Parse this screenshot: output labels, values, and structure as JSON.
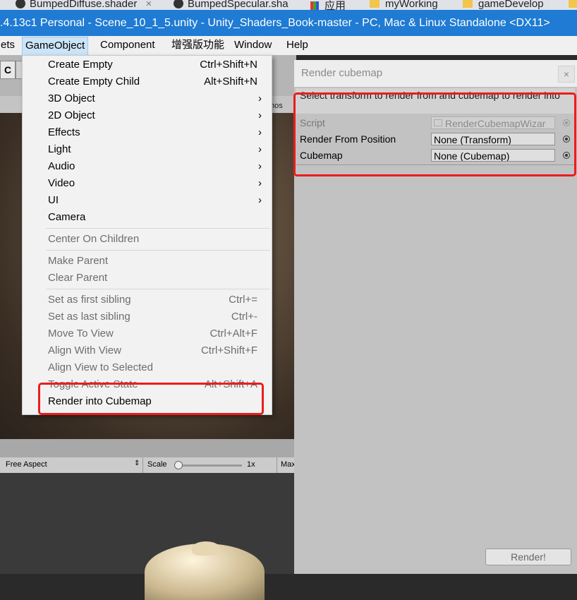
{
  "browser_tabs": [
    {
      "label": "BumpedDiffuse.shader",
      "close": "×"
    },
    {
      "label": "BumpedSpecular.sha"
    }
  ],
  "bookmarks": [
    "应用",
    "myWorking",
    "gameDevelop"
  ],
  "window_title": ".4.13c1 Personal - Scene_10_1_5.unity - Unity_Shaders_Book-master - PC, Mac & Linux Standalone <DX11>",
  "menubar": {
    "items": [
      "ets",
      "GameObject",
      "Component",
      "增强版功能",
      "Window",
      "Help"
    ],
    "active": "GameObject"
  },
  "menu": {
    "items": [
      {
        "label": "Create Empty",
        "shortcut": "Ctrl+Shift+N"
      },
      {
        "label": "Create Empty Child",
        "shortcut": "Alt+Shift+N"
      },
      {
        "label": "3D Object",
        "arrow": "›"
      },
      {
        "label": "2D Object",
        "arrow": "›"
      },
      {
        "label": "Effects",
        "arrow": "›"
      },
      {
        "label": "Light",
        "arrow": "›"
      },
      {
        "label": "Audio",
        "arrow": "›"
      },
      {
        "label": "Video",
        "arrow": "›"
      },
      {
        "label": "UI",
        "arrow": "›"
      },
      {
        "label": "Camera"
      },
      {
        "label": "Center On Children"
      },
      {
        "label": "Make Parent"
      },
      {
        "label": "Clear Parent"
      },
      {
        "label": "Set as first sibling",
        "shortcut": "Ctrl+="
      },
      {
        "label": "Set as last sibling",
        "shortcut": "Ctrl+-"
      },
      {
        "label": "Move To View",
        "shortcut": "Ctrl+Alt+F"
      },
      {
        "label": "Align With View",
        "shortcut": "Ctrl+Shift+F"
      },
      {
        "label": "Align View to Selected"
      },
      {
        "label": "Toggle Active State",
        "shortcut": "Alt+Shift+A"
      },
      {
        "label": "Render into Cubemap"
      }
    ]
  },
  "scene": {
    "gizmos": "mos"
  },
  "gamebar": {
    "aspect": "Free Aspect",
    "scale_label": "Scale",
    "scale_value": "1x",
    "max": "Max"
  },
  "wizard": {
    "title": "Render cubemap",
    "close": "×",
    "help": "Select transform to render from and cubemap to render into",
    "script_label": "Script",
    "script_value": "RenderCubemapWizar",
    "position_label": "Render From Position",
    "position_value": "None (Transform)",
    "cubemap_label": "Cubemap",
    "cubemap_value": "None (Cubemap)",
    "render_button": "Render!"
  },
  "colors": {
    "highlight": "#ec1c1c",
    "title_bar": "#1f7bd3"
  }
}
